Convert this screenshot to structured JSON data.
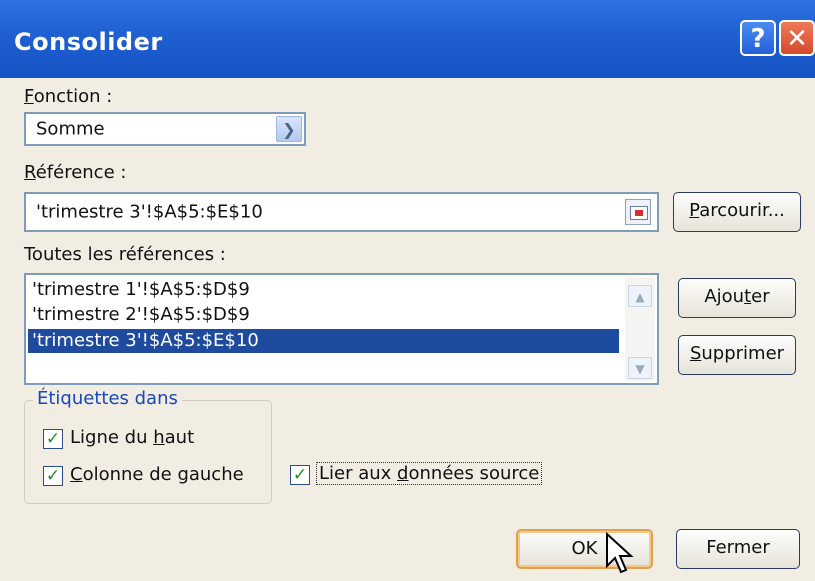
{
  "window": {
    "title": "Consolider",
    "help_glyph": "?",
    "close_glyph": "✕"
  },
  "fonction": {
    "label": "Fonction :",
    "value": "Somme"
  },
  "reference": {
    "label": "Référence :",
    "value": "'trimestre 3'!$A$5:$E$10"
  },
  "buttons": {
    "browse": "Parcourir...",
    "add": "Ajouter",
    "delete": "Supprimer",
    "ok": "OK",
    "close": "Fermer"
  },
  "all_refs": {
    "label": "Toutes les références :",
    "items": [
      "'trimestre 1'!$A$5:$D$9",
      "'trimestre 2'!$A$5:$D$9",
      "'trimestre 3'!$A$5:$E$10"
    ],
    "selected": 2
  },
  "labels_group": {
    "title": "Étiquettes dans",
    "top_row": {
      "label": "Ligne du haut",
      "checked": true
    },
    "left_col": {
      "label": "Colonne de gauche",
      "checked": true
    }
  },
  "link_source": {
    "label": "Lier aux données source",
    "checked": true
  },
  "colors": {
    "title_bar": "#1e5fd2",
    "selection": "#1e4b9e",
    "group_title": "#1a47b8",
    "check": "#1f8f2a"
  },
  "icons": {
    "dropdown": "chevron-down-icon",
    "collapse": "collapse-dialog-icon",
    "cursor": "mouse-pointer-icon"
  }
}
